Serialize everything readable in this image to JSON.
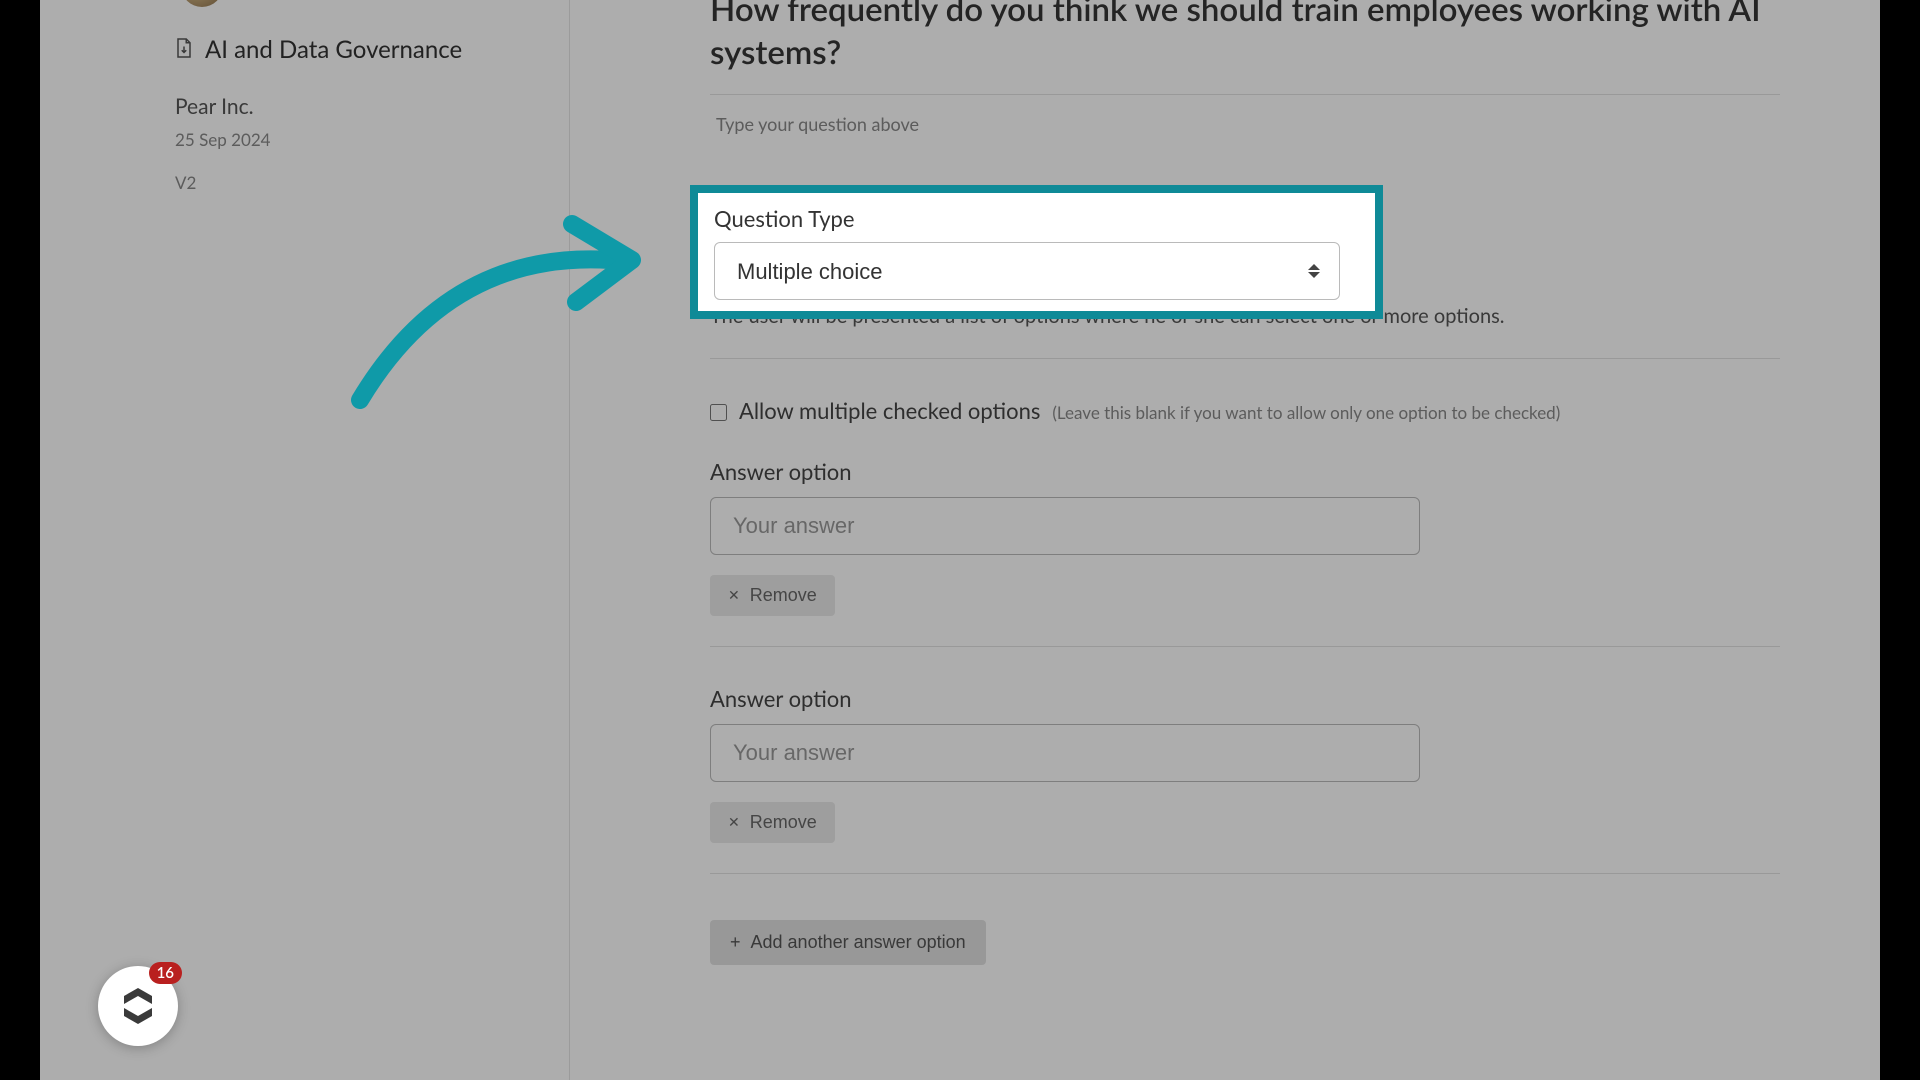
{
  "sidebar": {
    "doc_title": "AI and Data Governance",
    "company": "Pear Inc.",
    "date": "25 Sep 2024",
    "version": "V2"
  },
  "question": {
    "title": "How frequently do you think we should train employees working with AI systems?",
    "hint": "Type your question above",
    "type_label": "Question Type",
    "type_value": "Multiple choice",
    "type_desc": "The user will be presented a list of options where he or she can select one or more options."
  },
  "allow_multi": {
    "label": "Allow multiple checked options",
    "sub": "(Leave this blank if you want to allow only one option to be checked)",
    "checked": false
  },
  "answer_options": [
    {
      "label": "Answer option",
      "placeholder": "Your answer",
      "remove": "Remove"
    },
    {
      "label": "Answer option",
      "placeholder": "Your answer",
      "remove": "Remove"
    }
  ],
  "add_option_label": "Add another answer option",
  "chat": {
    "badge": "16"
  },
  "highlight": {
    "label": "Question Type",
    "value": "Multiple choice"
  }
}
